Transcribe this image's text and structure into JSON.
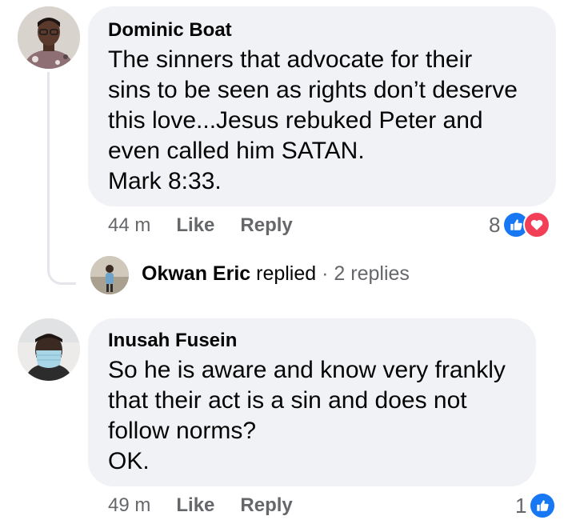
{
  "comments": [
    {
      "author": "Dominic Boat",
      "text": "The sinners that advocate for their\nsins to be seen as rights don’t deserve\nthis love...Jesus rebuked Peter and\neven called him SATAN.\nMark 8:33.",
      "time": "44 m",
      "like_label": "Like",
      "reply_label": "Reply",
      "reaction_count": "8",
      "reactions": [
        "like-icon",
        "love-icon"
      ],
      "replies": {
        "author": "Okwan Eric",
        "verb": "replied",
        "separator": "·",
        "count": "2 replies"
      }
    },
    {
      "author": "Inusah Fusein",
      "text": "So he is aware and know very frankly\nthat their act is a sin and does not\nfollow norms?\nOK.",
      "time": "49 m",
      "like_label": "Like",
      "reply_label": "Reply",
      "reaction_count": "1",
      "reactions": [
        "like-icon"
      ]
    }
  ],
  "colors": {
    "bubble": "#f0f2f5",
    "meta_text": "#65676b",
    "like_blue": "#1877f2",
    "love_red": "#f33e58",
    "thread_line": "#e4e6eb"
  }
}
